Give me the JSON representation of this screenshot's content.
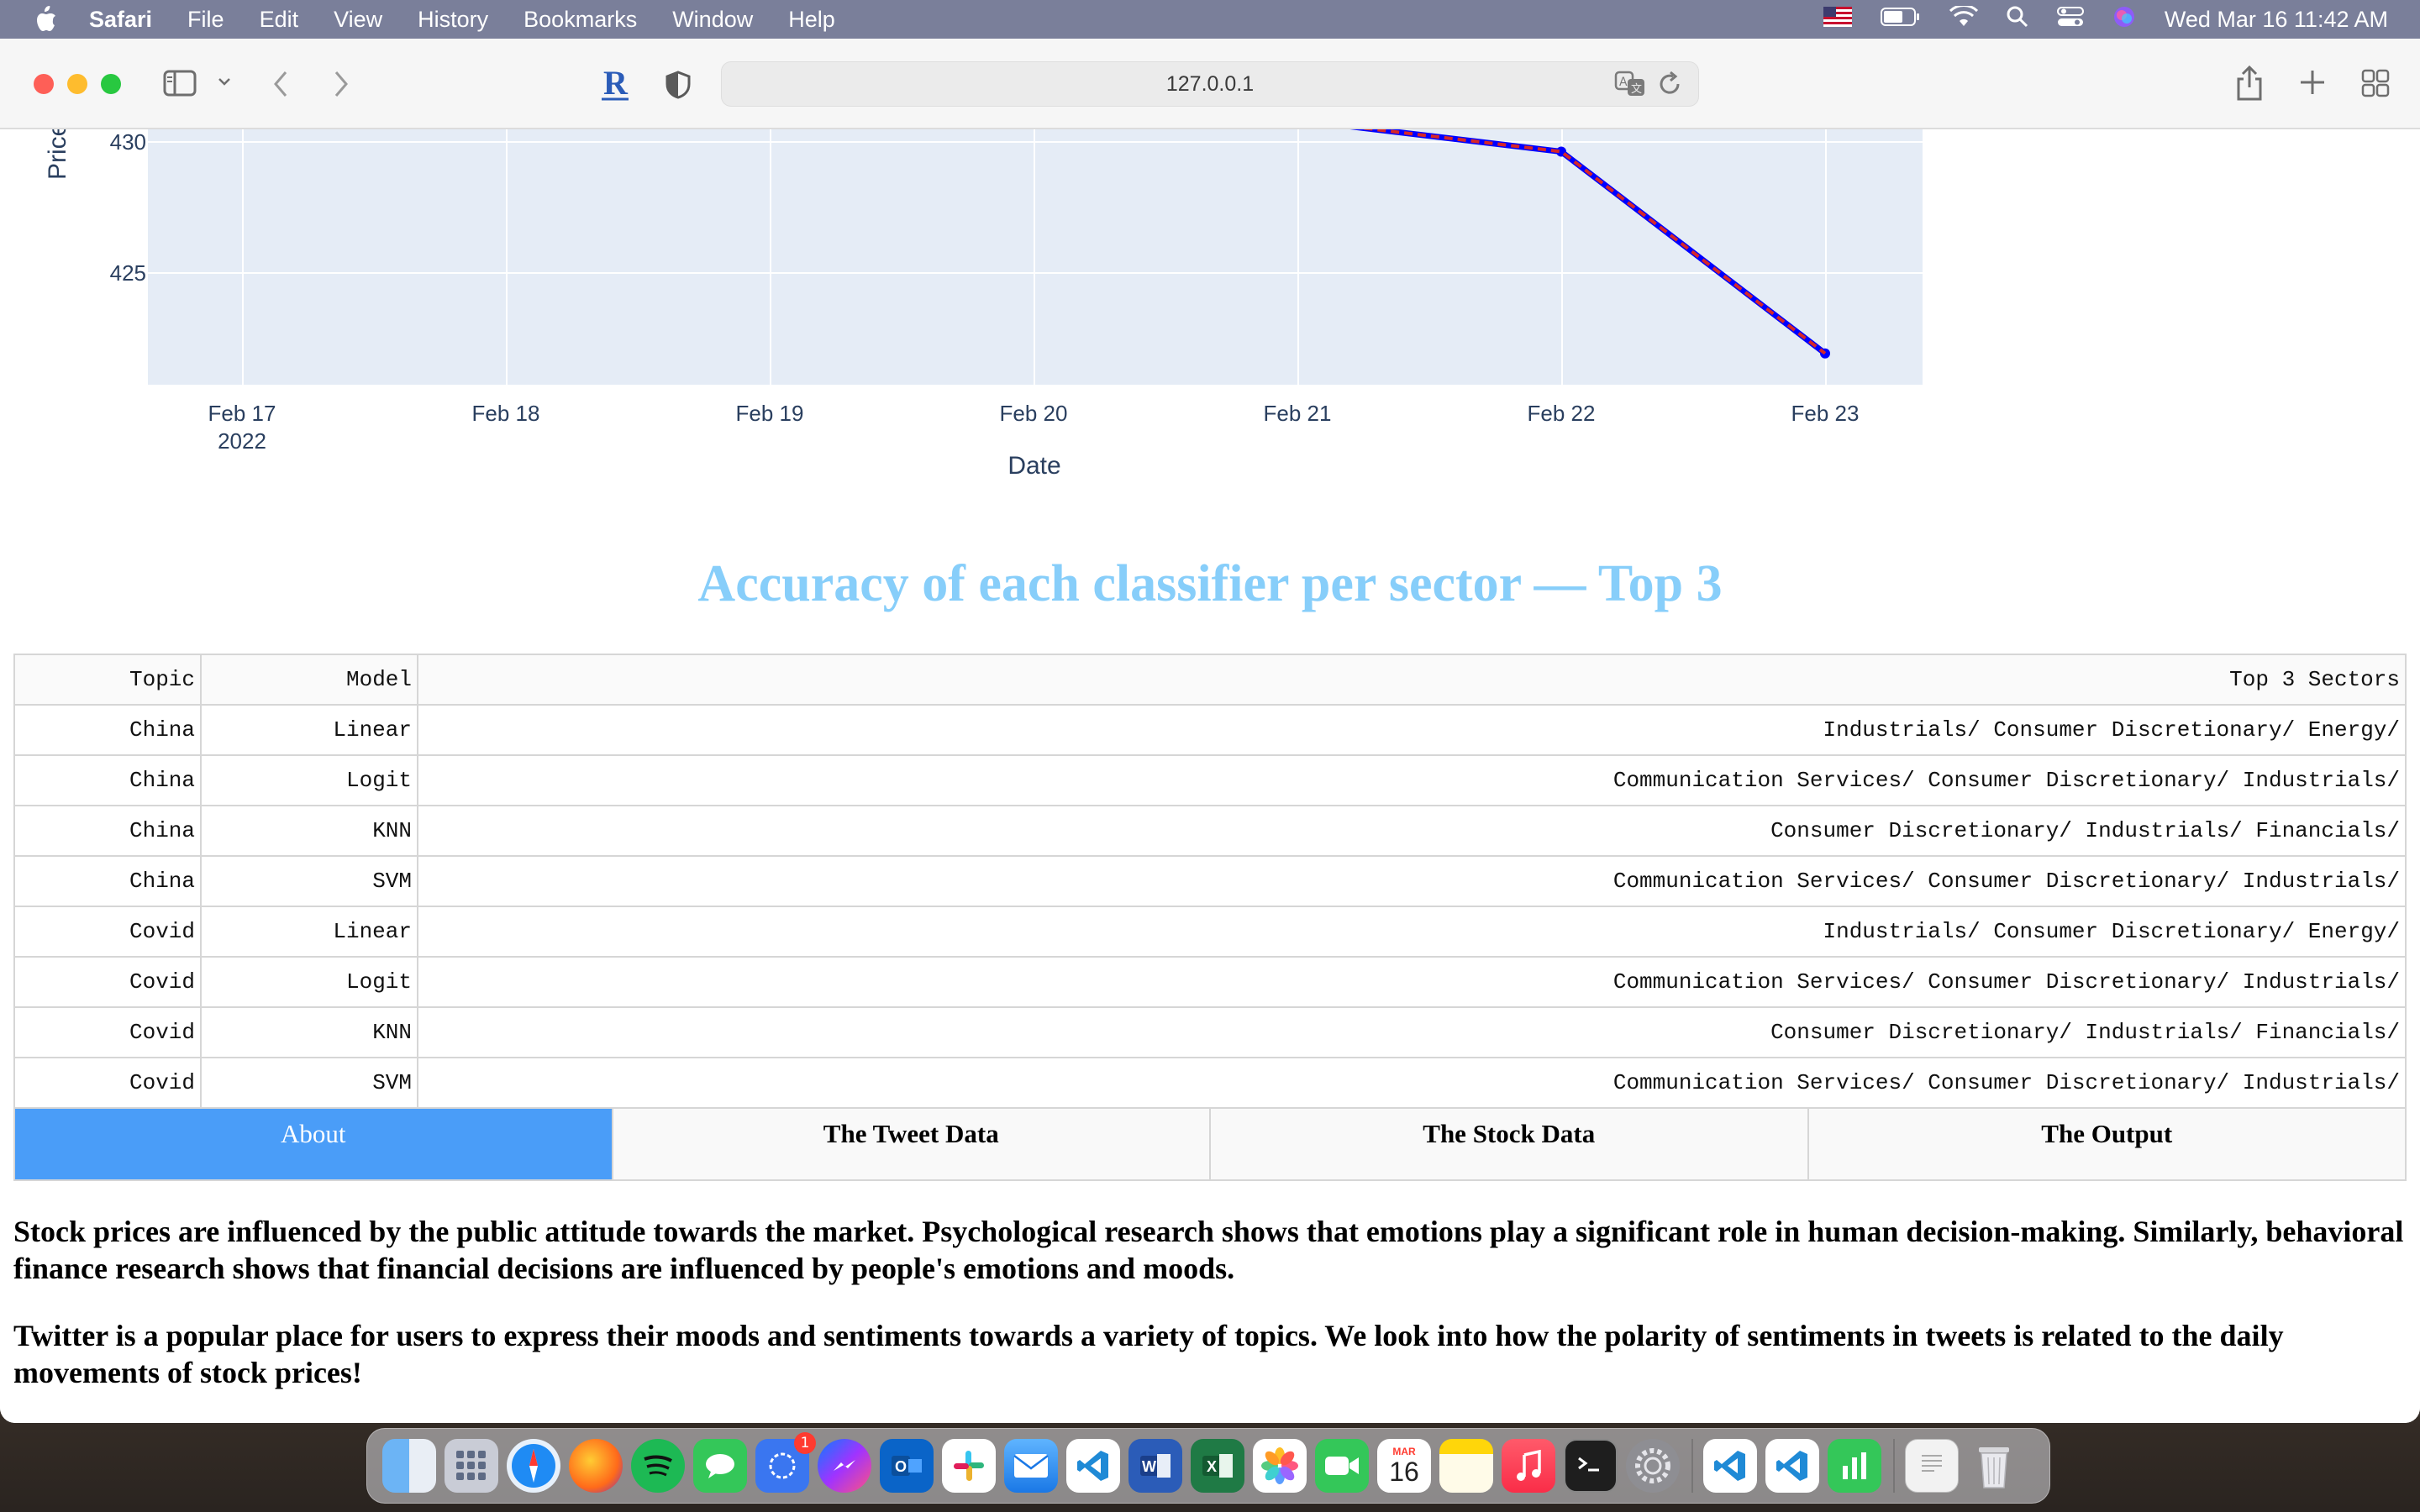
{
  "menubar": {
    "app_name": "Safari",
    "menus": [
      "File",
      "Edit",
      "View",
      "History",
      "Bookmarks",
      "Window",
      "Help"
    ],
    "clock": "Wed Mar 16  11:42 AM"
  },
  "browser": {
    "url": "127.0.0.1"
  },
  "chart_data": {
    "type": "line",
    "x": [
      "2022-02-21",
      "2022-02-22",
      "2022-02-23"
    ],
    "series": [
      {
        "values": [
          430.8,
          429.6,
          421.9
        ],
        "color": "#0000ff"
      },
      {
        "values": [
          430.8,
          429.6,
          421.9
        ],
        "color": "#d62728"
      }
    ],
    "x_ticks": [
      "Feb 17\n2022",
      "Feb 18",
      "Feb 19",
      "Feb 20",
      "Feb 21",
      "Feb 22",
      "Feb 23"
    ],
    "y_ticks": [
      "430",
      "425"
    ],
    "xlabel": "Date",
    "ylabel": "Price (",
    "xlim": [
      "2022-02-17",
      "2022-02-23"
    ],
    "ylim": [
      422,
      431
    ],
    "grid": true
  },
  "section_title": "Accuracy of each classifier per sector — Top 3",
  "table": {
    "headers": [
      "Topic",
      "Model",
      "Top 3 Sectors"
    ],
    "rows": [
      [
        "China",
        "Linear",
        "Industrials/ Consumer Discretionary/ Energy/"
      ],
      [
        "China",
        "Logit",
        "Communication Services/ Consumer Discretionary/ Industrials/"
      ],
      [
        "China",
        "KNN",
        "Consumer Discretionary/ Industrials/ Financials/"
      ],
      [
        "China",
        "SVM",
        "Communication Services/ Consumer Discretionary/ Industrials/"
      ],
      [
        "Covid",
        "Linear",
        "Industrials/ Consumer Discretionary/ Energy/"
      ],
      [
        "Covid",
        "Logit",
        "Communication Services/ Consumer Discretionary/ Industrials/"
      ],
      [
        "Covid",
        "KNN",
        "Consumer Discretionary/ Industrials/ Financials/"
      ],
      [
        "Covid",
        "SVM",
        "Communication Services/ Consumer Discretionary/ Industrials/"
      ]
    ]
  },
  "tabs": [
    {
      "label": "About",
      "active": true
    },
    {
      "label": "The Tweet Data",
      "active": false
    },
    {
      "label": "The Stock Data",
      "active": false
    },
    {
      "label": "The Output",
      "active": false
    }
  ],
  "about": {
    "p1": "Stock prices are influenced by the public attitude towards the market. Psychological research shows that emotions play a significant role in human decision-making. Similarly, behavioral finance research shows that financial decisions are influenced by people's emotions and moods.",
    "p2": "Twitter is a popular place for users to express their moods and sentiments towards a variety of topics. We look into how the polarity of sentiments in tweets is related to the daily movements of stock prices!"
  },
  "dock": {
    "calendar_month": "MAR",
    "calendar_day": "16",
    "signal_badge": "1",
    "items": [
      "finder-icon",
      "launchpad-icon",
      "safari-icon",
      "firefox-icon",
      "spotify-icon",
      "messages-icon",
      "signal-icon",
      "messenger-icon",
      "outlook-icon",
      "slack-icon",
      "mail-icon",
      "vscode-icon",
      "word-icon",
      "excel-icon",
      "photos-icon",
      "facetime-icon",
      "calendar-icon",
      "notes-icon",
      "music-icon",
      "terminal-icon",
      "system-preferences-icon",
      "vscode-icon",
      "vscode-icon",
      "numbers-icon",
      "document-icon",
      "trash-icon"
    ]
  }
}
